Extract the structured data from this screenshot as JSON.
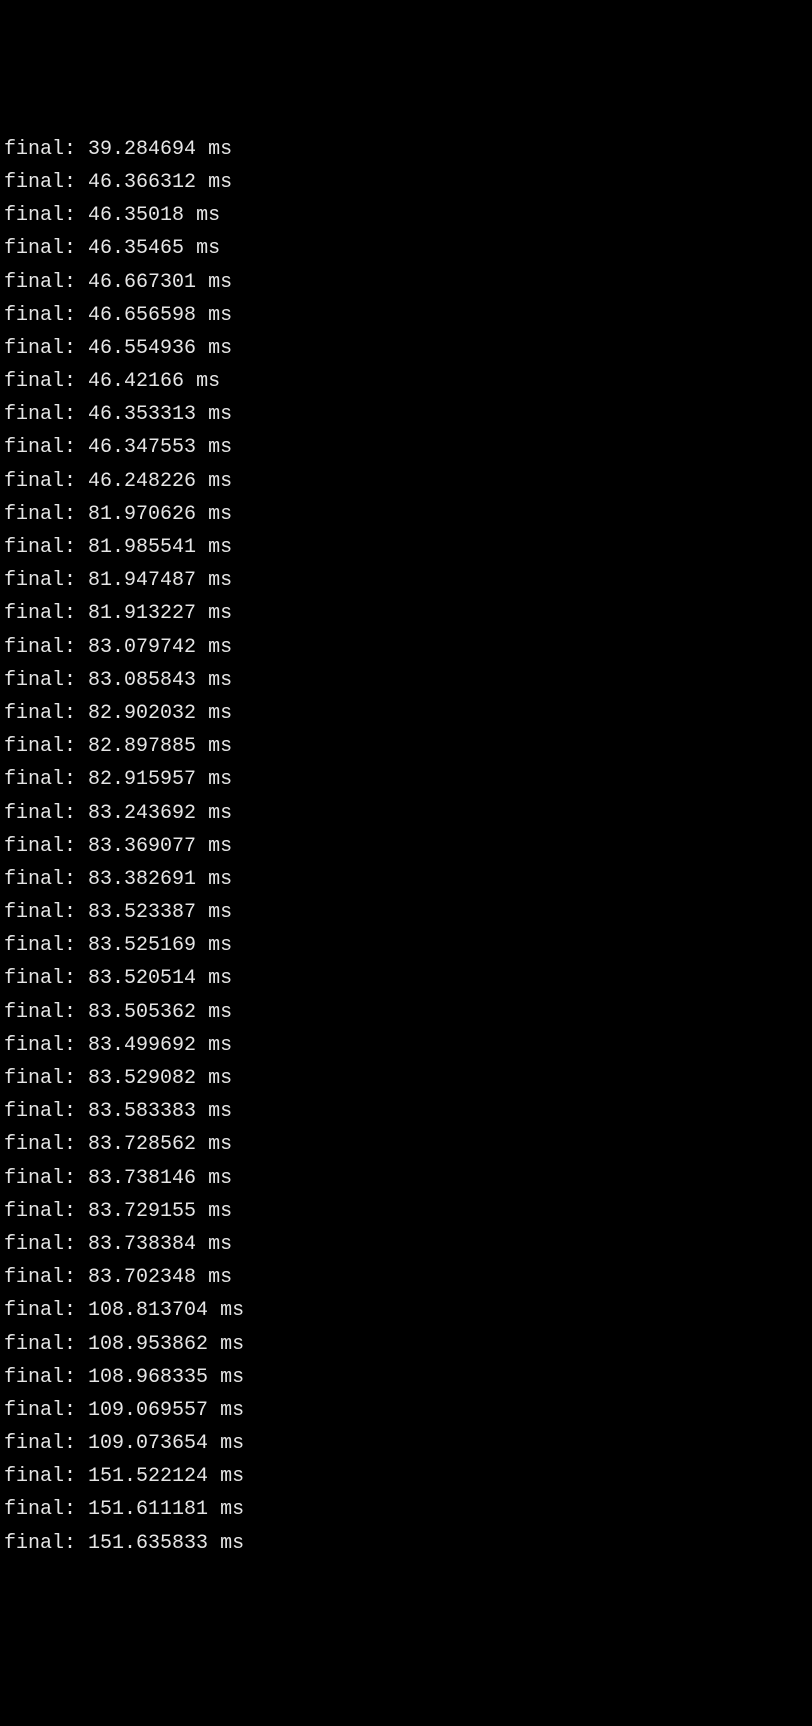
{
  "terminal": {
    "lines": [
      {
        "label": "final:",
        "value": "39.284694",
        "unit": "ms"
      },
      {
        "label": "final:",
        "value": "46.366312",
        "unit": "ms"
      },
      {
        "label": "final:",
        "value": "46.35018",
        "unit": "ms"
      },
      {
        "label": "final:",
        "value": "46.35465",
        "unit": "ms"
      },
      {
        "label": "final:",
        "value": "46.667301",
        "unit": "ms"
      },
      {
        "label": "final:",
        "value": "46.656598",
        "unit": "ms"
      },
      {
        "label": "final:",
        "value": "46.554936",
        "unit": "ms"
      },
      {
        "label": "final:",
        "value": "46.42166",
        "unit": "ms"
      },
      {
        "label": "final:",
        "value": "46.353313",
        "unit": "ms"
      },
      {
        "label": "final:",
        "value": "46.347553",
        "unit": "ms"
      },
      {
        "label": "final:",
        "value": "46.248226",
        "unit": "ms"
      },
      {
        "label": "final:",
        "value": "81.970626",
        "unit": "ms"
      },
      {
        "label": "final:",
        "value": "81.985541",
        "unit": "ms"
      },
      {
        "label": "final:",
        "value": "81.947487",
        "unit": "ms"
      },
      {
        "label": "final:",
        "value": "81.913227",
        "unit": "ms"
      },
      {
        "label": "final:",
        "value": "83.079742",
        "unit": "ms"
      },
      {
        "label": "final:",
        "value": "83.085843",
        "unit": "ms"
      },
      {
        "label": "final:",
        "value": "82.902032",
        "unit": "ms"
      },
      {
        "label": "final:",
        "value": "82.897885",
        "unit": "ms"
      },
      {
        "label": "final:",
        "value": "82.915957",
        "unit": "ms"
      },
      {
        "label": "final:",
        "value": "83.243692",
        "unit": "ms"
      },
      {
        "label": "final:",
        "value": "83.369077",
        "unit": "ms"
      },
      {
        "label": "final:",
        "value": "83.382691",
        "unit": "ms"
      },
      {
        "label": "final:",
        "value": "83.523387",
        "unit": "ms"
      },
      {
        "label": "final:",
        "value": "83.525169",
        "unit": "ms"
      },
      {
        "label": "final:",
        "value": "83.520514",
        "unit": "ms"
      },
      {
        "label": "final:",
        "value": "83.505362",
        "unit": "ms"
      },
      {
        "label": "final:",
        "value": "83.499692",
        "unit": "ms"
      },
      {
        "label": "final:",
        "value": "83.529082",
        "unit": "ms"
      },
      {
        "label": "final:",
        "value": "83.583383",
        "unit": "ms"
      },
      {
        "label": "final:",
        "value": "83.728562",
        "unit": "ms"
      },
      {
        "label": "final:",
        "value": "83.738146",
        "unit": "ms"
      },
      {
        "label": "final:",
        "value": "83.729155",
        "unit": "ms"
      },
      {
        "label": "final:",
        "value": "83.738384",
        "unit": "ms"
      },
      {
        "label": "final:",
        "value": "83.702348",
        "unit": "ms"
      },
      {
        "label": "final:",
        "value": "108.813704",
        "unit": "ms"
      },
      {
        "label": "final:",
        "value": "108.953862",
        "unit": "ms"
      },
      {
        "label": "final:",
        "value": "108.968335",
        "unit": "ms"
      },
      {
        "label": "final:",
        "value": "109.069557",
        "unit": "ms"
      },
      {
        "label": "final:",
        "value": "109.073654",
        "unit": "ms"
      },
      {
        "label": "final:",
        "value": "151.522124",
        "unit": "ms"
      },
      {
        "label": "final:",
        "value": "151.611181",
        "unit": "ms"
      },
      {
        "label": "final:",
        "value": "151.635833",
        "unit": "ms"
      }
    ]
  }
}
